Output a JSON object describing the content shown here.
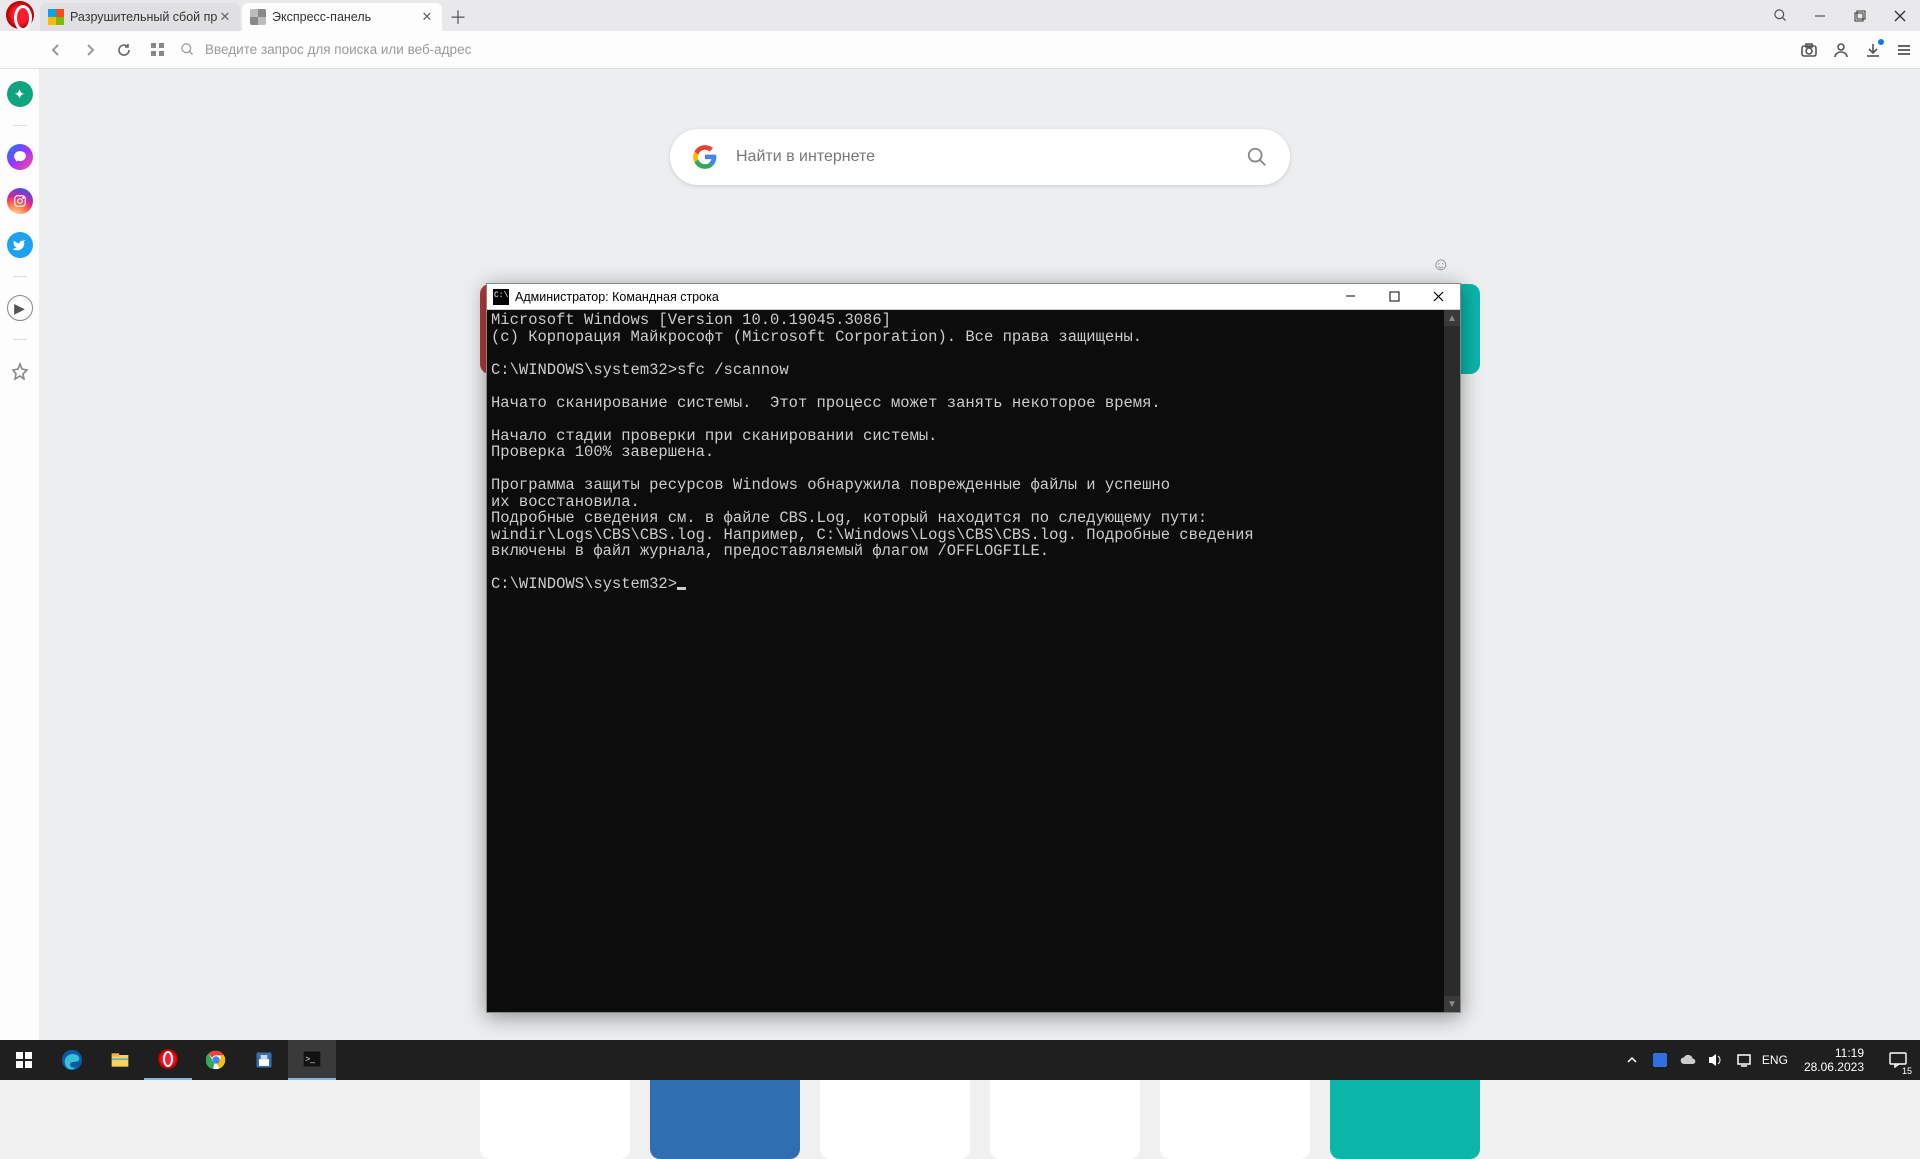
{
  "tabs": [
    {
      "title": "Разрушительный сбой пр",
      "favclass": "fav-ms"
    },
    {
      "title": "Экспресс-панель",
      "favclass": "fav-sd"
    }
  ],
  "addressbar": {
    "placeholder": "Введите запрос для поиска или веб-адрес"
  },
  "speeddial": {
    "search_placeholder": "Найти в интернете",
    "row1_colors": [
      "#b63a3a",
      "#ffffff",
      "#6a1b9a",
      "#e88c1a",
      "#e64a19",
      "#0bb5a8"
    ],
    "row2_colors": [
      "#ffffff",
      "#2f6fb0",
      "#ffffff",
      "#ffffff",
      "#ffffff",
      "#0bb5a8"
    ]
  },
  "cmd": {
    "title": "Администратор: Командная строка",
    "lines": [
      "Microsoft Windows [Version 10.0.19045.3086]",
      "(c) Корпорация Майкрософт (Microsoft Corporation). Все права защищены.",
      "",
      "C:\\WINDOWS\\system32>sfc /scannow",
      "",
      "Начато сканирование системы.  Этот процесс может занять некоторое время.",
      "",
      "Начало стадии проверки при сканировании системы.",
      "Проверка 100% завершена.",
      "",
      "Программа защиты ресурсов Windows обнаружила поврежденные файлы и успешно",
      "их восстановила.",
      "Подробные сведения см. в файле CBS.Log, который находится по следующему пути:",
      "windir\\Logs\\CBS\\CBS.log. Например, C:\\Windows\\Logs\\CBS\\CBS.log. Подробные сведения",
      "включены в файл журнала, предоставляемый флагом /OFFLOGFILE.",
      "",
      "C:\\WINDOWS\\system32>"
    ]
  },
  "taskbar": {
    "lang": "ENG",
    "time": "11:19",
    "date": "28.06.2023",
    "notif_count": "15"
  }
}
